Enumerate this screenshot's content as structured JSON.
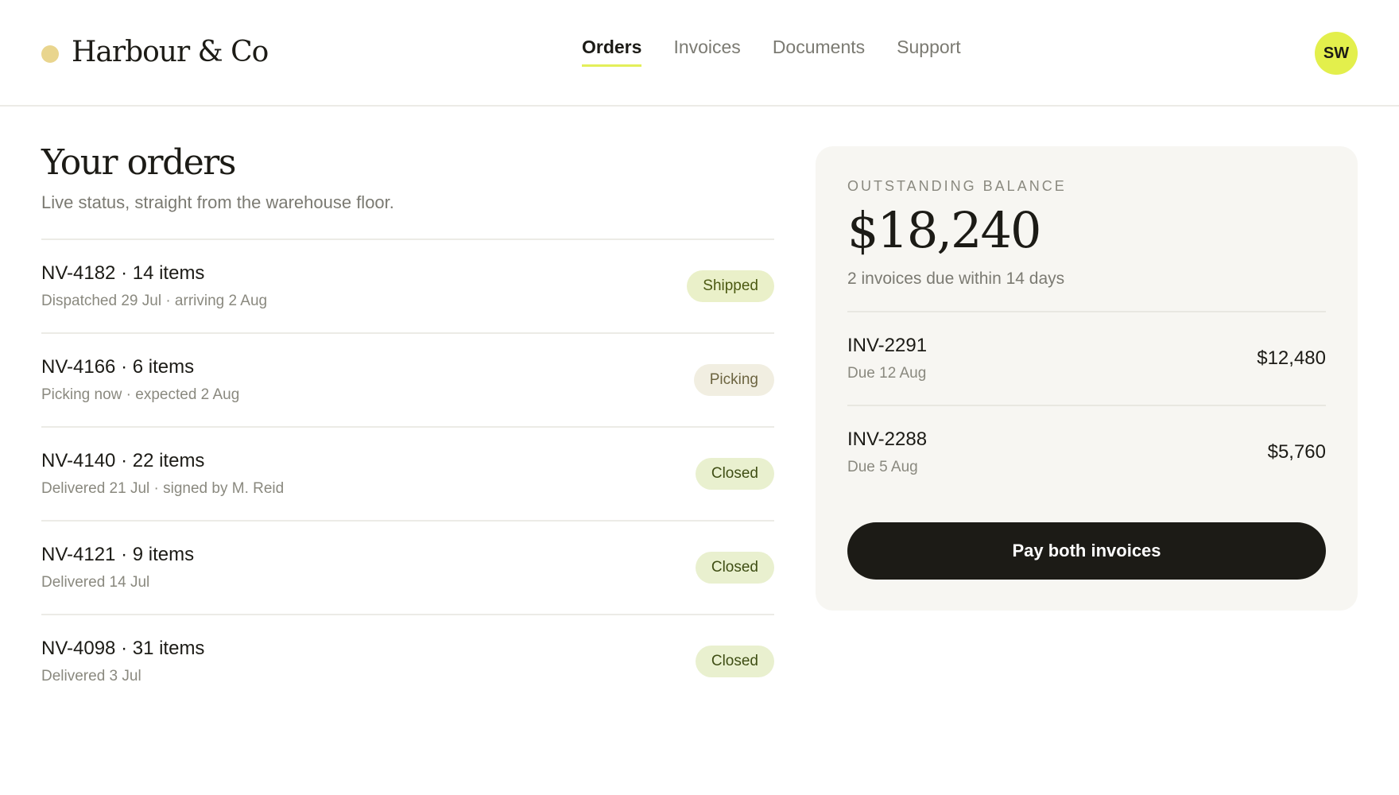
{
  "header": {
    "brand": "Harbour & Co",
    "nav": [
      "Orders",
      "Invoices",
      "Documents",
      "Support"
    ],
    "active_nav": "Orders",
    "avatar_initials": "SW"
  },
  "orders": {
    "title": "Your orders",
    "subtitle": "Live status, straight from the warehouse floor.",
    "items": [
      {
        "title": "NV-4182 · 14 items",
        "detail": "Dispatched 29 Jul · arriving 2 Aug",
        "status": "Shipped"
      },
      {
        "title": "NV-4166 · 6 items",
        "detail": "Picking now · expected 2 Aug",
        "status": "Picking"
      },
      {
        "title": "NV-4140 · 22 items",
        "detail": "Delivered 21 Jul · signed by M. Reid",
        "status": "Closed"
      },
      {
        "title": "NV-4121 · 9 items",
        "detail": "Delivered 14 Jul",
        "status": "Closed"
      },
      {
        "title": "NV-4098 · 31 items",
        "detail": "Delivered 3 Jul",
        "status": "Closed"
      }
    ]
  },
  "balance": {
    "label": "OUTSTANDING BALANCE",
    "amount": "$18,240",
    "note": "2 invoices due within 14 days",
    "invoices": [
      {
        "id": "INV-2291",
        "due": "Due 12 Aug",
        "amount": "$12,480"
      },
      {
        "id": "INV-2288",
        "due": "Due 5 Aug",
        "amount": "$5,760"
      }
    ],
    "pay_button": "Pay both invoices"
  },
  "colors": {
    "accent": "#e3ef4c",
    "brand_dot": "#e9d58e",
    "button": "#1c1b16",
    "card_bg": "#f7f6f2"
  }
}
